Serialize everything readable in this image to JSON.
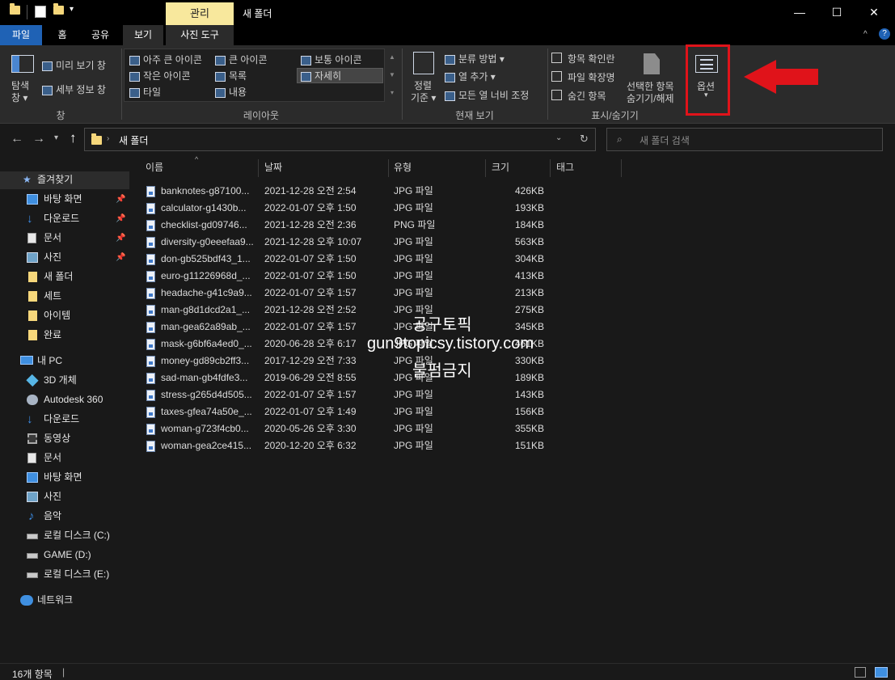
{
  "window": {
    "context_tab": "관리",
    "title": "새 폴더"
  },
  "ribbon_tabs": [
    "파일",
    "홈",
    "공유",
    "보기",
    "사진 도구"
  ],
  "ribbon": {
    "pane": {
      "nav_pane": "탐색",
      "nav_pane2": "창",
      "preview": "미리 보기 창",
      "details": "세부 정보 창",
      "group": "창"
    },
    "layout": {
      "items": [
        "아주 큰 아이콘",
        "큰 아이콘",
        "보통 아이콘",
        "작은 아이콘",
        "목록",
        "자세히",
        "타일",
        "내용"
      ],
      "group": "레이아웃"
    },
    "current_view": {
      "sort1": "정렬",
      "sort2": "기준",
      "group_by": "분류 방법",
      "add_col": "열 추가",
      "fit_cols": "모든 열 너비 조정",
      "group": "현재 보기"
    },
    "show_hide": {
      "checkboxes": "항목 확인란",
      "extensions": "파일 확장명",
      "hidden": "숨긴 항목",
      "hide_sel1": "선택한 항목",
      "hide_sel2": "숨기기/해제",
      "group": "표시/숨기기"
    },
    "options": "옵션"
  },
  "address": {
    "path": "새 폴더",
    "search_placeholder": "새 폴더 검색"
  },
  "nav": {
    "quick_access": "즐겨찾기",
    "quick_items": [
      "바탕 화면",
      "다운로드",
      "문서",
      "사진",
      "새 폴더",
      "세트",
      "아이템",
      "완료"
    ],
    "this_pc": "내 PC",
    "pc_items": [
      "3D 개체",
      "Autodesk 360",
      "다운로드",
      "동영상",
      "문서",
      "바탕 화면",
      "사진",
      "음악",
      "로컬 디스크 (C:)",
      "GAME (D:)",
      "로컬 디스크 (E:)"
    ],
    "network": "네트워크"
  },
  "columns": [
    "이름",
    "날짜",
    "유형",
    "크기",
    "태그"
  ],
  "files": [
    {
      "name": "banknotes-g87100...",
      "date": "2021-12-28 오전 2:54",
      "type": "JPG 파일",
      "size": "426KB"
    },
    {
      "name": "calculator-g1430b...",
      "date": "2022-01-07 오후 1:50",
      "type": "JPG 파일",
      "size": "193KB"
    },
    {
      "name": "checklist-gd09746...",
      "date": "2021-12-28 오전 2:36",
      "type": "PNG 파일",
      "size": "184KB"
    },
    {
      "name": "diversity-g0eeefaa9...",
      "date": "2021-12-28 오후 10:07",
      "type": "JPG 파일",
      "size": "563KB"
    },
    {
      "name": "don-gb525bdf43_1...",
      "date": "2022-01-07 오후 1:50",
      "type": "JPG 파일",
      "size": "304KB"
    },
    {
      "name": "euro-g11226968d_...",
      "date": "2022-01-07 오후 1:50",
      "type": "JPG 파일",
      "size": "413KB"
    },
    {
      "name": "headache-g41c9a9...",
      "date": "2022-01-07 오후 1:57",
      "type": "JPG 파일",
      "size": "213KB"
    },
    {
      "name": "man-g8d1dcd2a1_...",
      "date": "2021-12-28 오전 2:52",
      "type": "JPG 파일",
      "size": "275KB"
    },
    {
      "name": "man-gea62a89ab_...",
      "date": "2022-01-07 오후 1:57",
      "type": "JPG 파일",
      "size": "345KB"
    },
    {
      "name": "mask-g6bf6a4ed0_...",
      "date": "2020-06-28 오후 6:17",
      "type": "JPG 파일",
      "size": "461KB"
    },
    {
      "name": "money-gd89cb2ff3...",
      "date": "2017-12-29 오전 7:33",
      "type": "JPG 파일",
      "size": "330KB"
    },
    {
      "name": "sad-man-gb4fdfe3...",
      "date": "2019-06-29 오전 8:55",
      "type": "JPG 파일",
      "size": "189KB"
    },
    {
      "name": "stress-g265d4d505...",
      "date": "2022-01-07 오후 1:57",
      "type": "JPG 파일",
      "size": "143KB"
    },
    {
      "name": "taxes-gfea74a50e_...",
      "date": "2022-01-07 오후 1:49",
      "type": "JPG 파일",
      "size": "156KB"
    },
    {
      "name": "woman-g723f4cb0...",
      "date": "2020-05-26 오후 3:30",
      "type": "JPG 파일",
      "size": "355KB"
    },
    {
      "name": "woman-gea2ce415...",
      "date": "2020-12-20 오후 6:32",
      "type": "JPG 파일",
      "size": "151KB"
    }
  ],
  "status": {
    "count": "16개 항목"
  },
  "watermark": {
    "line1": "공구토픽",
    "line2": "gun9topicsy.tistory.com",
    "line3": "불펌금지"
  },
  "colors": {
    "file_tab": "#1f62b5",
    "context_tab": "#f8e89d",
    "highlight": "#e0131a"
  }
}
